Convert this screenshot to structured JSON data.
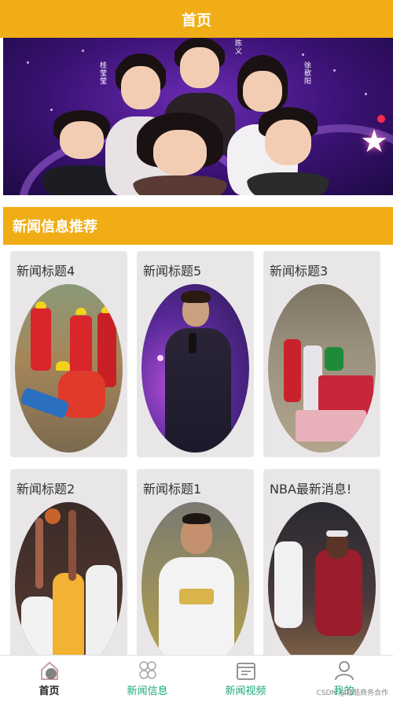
{
  "header": {
    "title": "首页"
  },
  "banner": {
    "captions": [
      "桂莹莹",
      "徐歌阳",
      "陈义"
    ]
  },
  "section": {
    "title": "新闻信息推荐"
  },
  "news": [
    {
      "title": "新闻标题4",
      "image": "rescue-workers-photo"
    },
    {
      "title": "新闻标题5",
      "image": "singer-stage-photo"
    },
    {
      "title": "新闻标题3",
      "image": "village-event-photo"
    },
    {
      "title": "新闻标题2",
      "image": "basketball-players-photo"
    },
    {
      "title": "新闻标题1",
      "image": "basketball-shout-photo"
    },
    {
      "title": "NBA最新消息!",
      "image": "nba-game-photo"
    }
  ],
  "tabbar": {
    "tabs": [
      {
        "label": "首页",
        "icon": "home-icon"
      },
      {
        "label": "新闻信息",
        "icon": "grid-icon"
      },
      {
        "label": "新闻视频",
        "icon": "calendar-icon"
      },
      {
        "label": "我的",
        "icon": "user-icon"
      }
    ]
  },
  "watermark": "CSDN @易酷商务合作"
}
